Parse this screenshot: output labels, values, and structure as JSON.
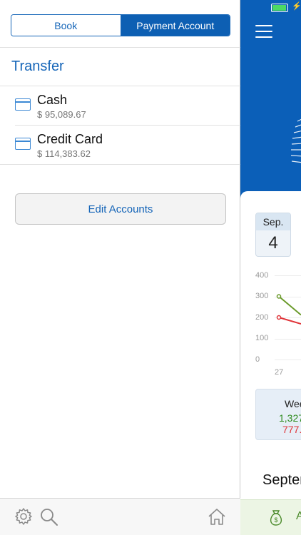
{
  "segment": {
    "book_label": "Book",
    "payment_label": "Payment Account",
    "selected": "Payment Account"
  },
  "transfer_label": "Transfer",
  "accounts": [
    {
      "name": "Cash",
      "amount": "$ 95,089.67",
      "icon": "card-icon"
    },
    {
      "name": "Credit Card",
      "amount": "$ 114,383.62",
      "icon": "card-icon"
    }
  ],
  "edit_accounts_label": "Edit Accounts",
  "toolbar": {
    "icons": [
      "gear-icon",
      "search-icon",
      "home-icon"
    ]
  },
  "main": {
    "date_month": "Sep.",
    "date_day": "4",
    "y_ticks": [
      "400",
      "300",
      "200",
      "100",
      "0"
    ],
    "x_tick": "27",
    "week_title": "Wee",
    "week_income": "1,327",
    "week_expense": "777.",
    "section_title": "Septer",
    "bottom_label": "A"
  },
  "chart_data": {
    "type": "line",
    "x": [
      "27"
    ],
    "ylim": [
      0,
      400
    ],
    "series": [
      {
        "color": "#6a9a2a",
        "values": [
          300
        ]
      },
      {
        "color": "#e0353a",
        "values": [
          200
        ]
      }
    ]
  },
  "colors": {
    "accent": "#0b5fb8",
    "income": "#2e8b1e",
    "expense": "#e0353a"
  }
}
